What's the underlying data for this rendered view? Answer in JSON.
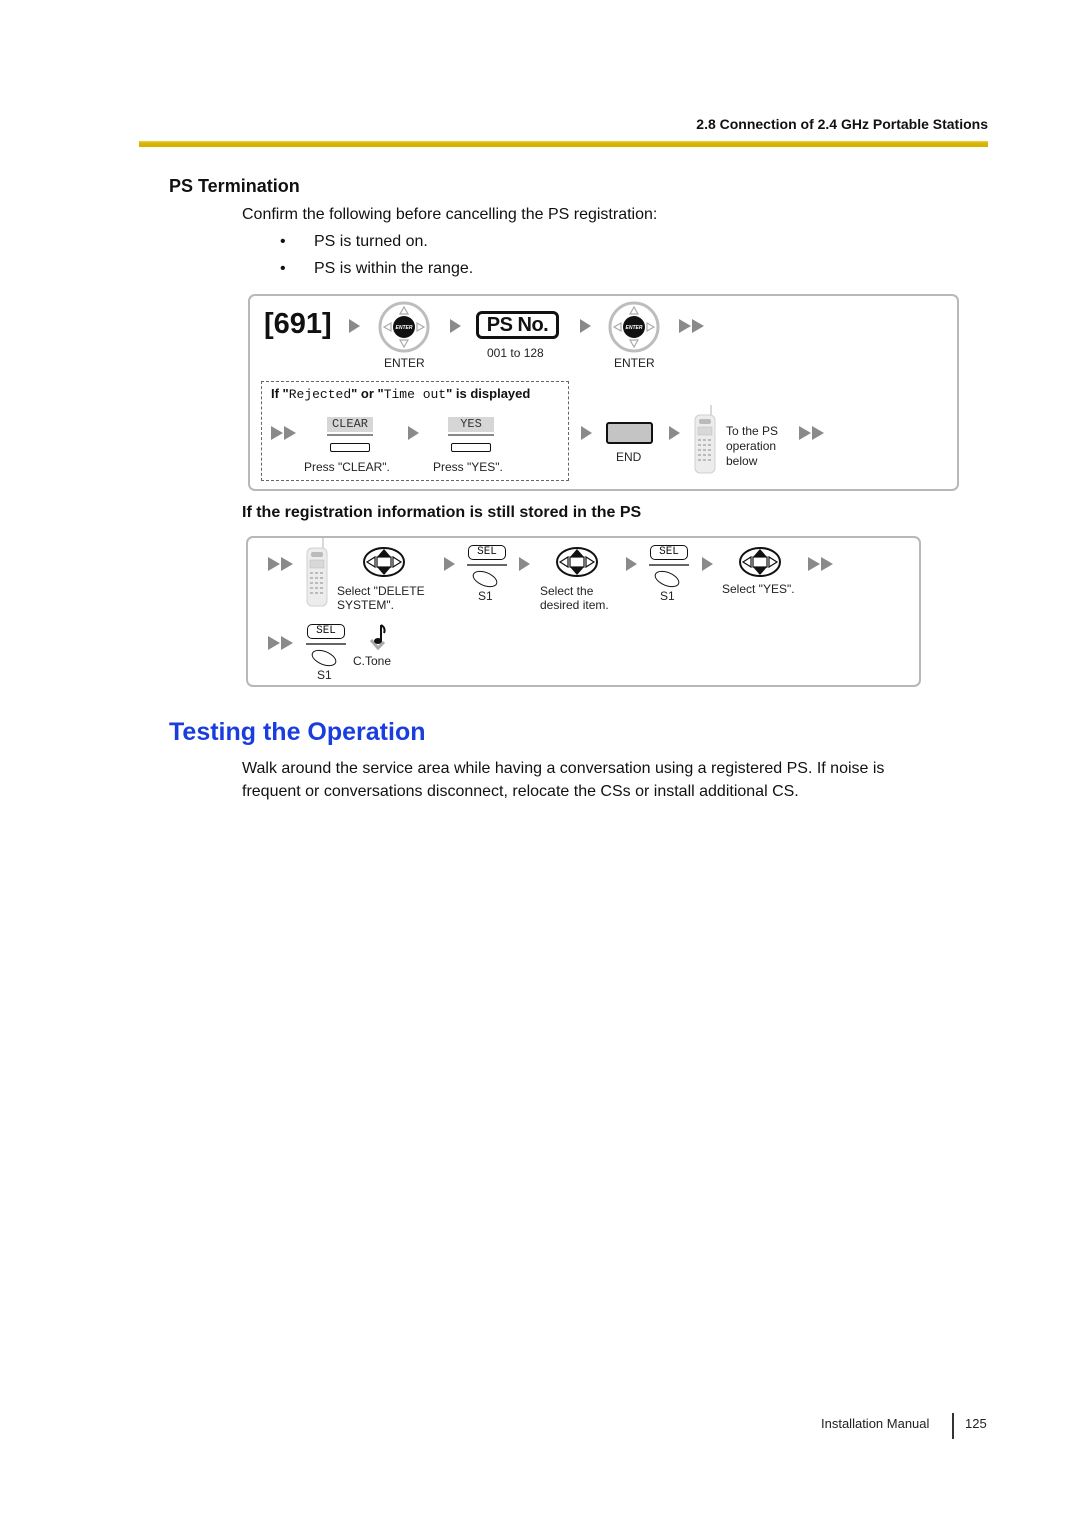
{
  "header": {
    "section_title": "2.8 Connection of 2.4 GHz Portable Stations",
    "rule_color": "#d9b200"
  },
  "ps_termination": {
    "heading": "PS Termination",
    "intro": "Confirm the following before cancelling the PS registration:",
    "bullets": [
      {
        "marker": "•",
        "text": "PS is turned on."
      },
      {
        "marker": "•",
        "text": "PS is within the range."
      }
    ]
  },
  "procedure_main": {
    "program_code": "[691]",
    "enter_key_glyph": "ENTER",
    "enter_label_1": "ENTER",
    "ps_no_label": "PS No.",
    "ps_no_range": "001 to 128",
    "enter_label_2": "ENTER",
    "condition_prefix": "If \"",
    "condition_rejected": "Rejected",
    "condition_or": "\" or \"",
    "condition_timeout": "Time out",
    "condition_suffix": "\" is displayed",
    "clear_softkey": "CLEAR",
    "clear_caption": "Press \"CLEAR\".",
    "yes_softkey": "YES",
    "yes_caption": "Press \"YES\".",
    "end_label": "END",
    "to_ps_line1": "To the PS",
    "to_ps_line2": "operation",
    "to_ps_line3": "below"
  },
  "procedure_ps": {
    "heading": "If the registration information is still stored in the PS",
    "step1_line1": "Select \"DELETE",
    "step1_line2": "SYSTEM\".",
    "sel_label": "SEL",
    "s1_label": "S1",
    "step2_line1": "Select the",
    "step2_line2": "desired item.",
    "step3": "Select \"YES\".",
    "ctone_label": "C.Tone"
  },
  "testing": {
    "heading": "Testing the Operation",
    "heading_color": "#1a3de0",
    "body_line1": "Walk around the service area while having a conversation using a registered PS. If noise is",
    "body_line2": "frequent or conversations disconnect, relocate the CSs or install additional CS."
  },
  "footer": {
    "label": "Installation Manual",
    "page_number": "125"
  }
}
